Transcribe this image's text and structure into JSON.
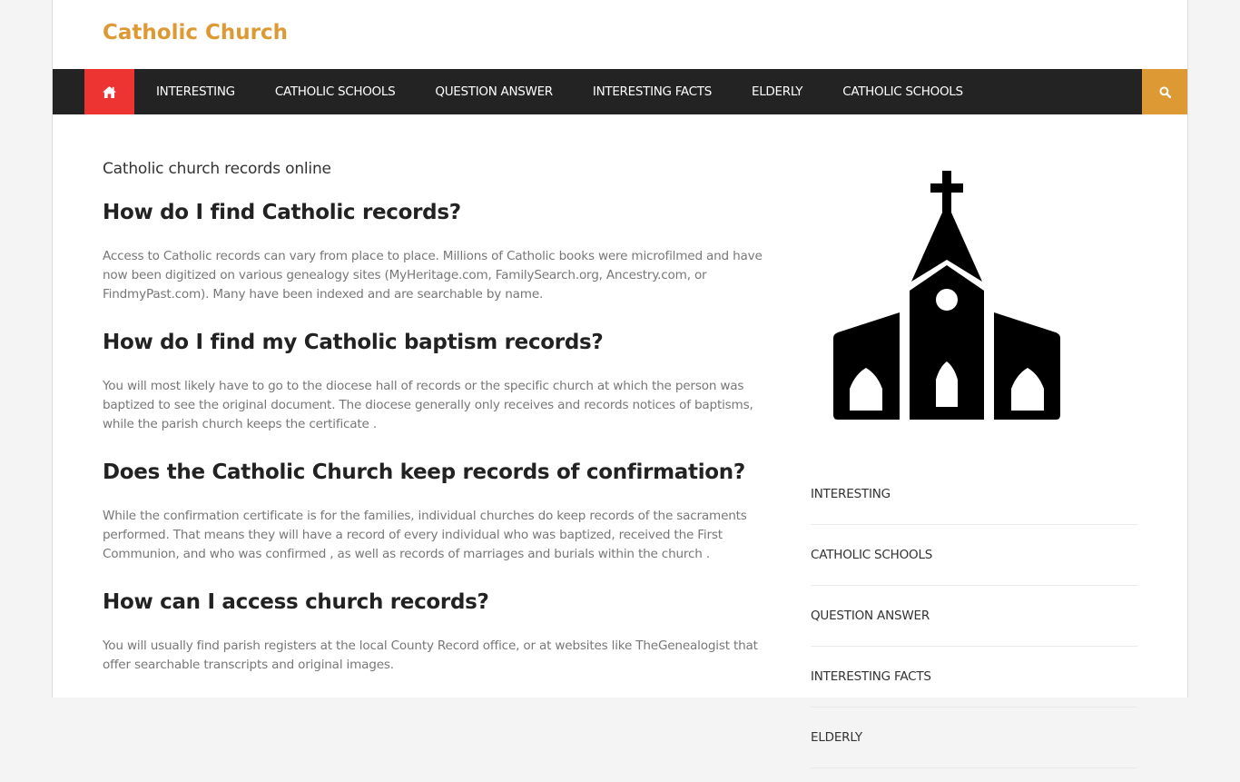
{
  "site": {
    "title": "Catholic Church",
    "accent_color": "#dd9933",
    "home_color": "#ee3333",
    "nav_bg": "#232323"
  },
  "nav": {
    "home_icon": "home-icon",
    "search_icon": "search-icon",
    "items": [
      {
        "label": "INTERESTING"
      },
      {
        "label": "CATHOLIC SCHOOLS"
      },
      {
        "label": "QUESTION ANSWER"
      },
      {
        "label": "INTERESTING FACTS"
      },
      {
        "label": "ELDERLY"
      },
      {
        "label": "CATHOLIC SCHOOLS"
      }
    ]
  },
  "main": {
    "subtitle": "Catholic church records online",
    "sections": [
      {
        "heading": "How do I find Catholic records?",
        "body": "Access to Catholic records can vary from place to place. Millions of Catholic books were microfilmed and have now been digitized on various genealogy sites (MyHeritage.com, FamilySearch.org, Ancestry.com, or FindmyPast.com). Many have been indexed and are searchable by name."
      },
      {
        "heading": "How do I find my Catholic baptism records?",
        "body": "You will most likely have to go to the diocese hall of records or the specific church at which the person was baptized to see the original document. The diocese generally only receives and records notices of baptisms, while the parish church keeps the certificate ."
      },
      {
        "heading": "Does the Catholic Church keep records of confirmation?",
        "body": "While the confirmation certificate is for the families, individual churches do keep records of the sacraments performed. That means they will have a record of every individual who was baptized, received the First Communion, and who was confirmed , as well as records of marriages and burials within the church ."
      },
      {
        "heading": "How can I access church records?",
        "body": "You will usually find parish registers at the local County Record office, or at websites like TheGenealogist that offer searchable transcripts and original images."
      }
    ]
  },
  "sidebar": {
    "image_icon": "church-icon",
    "categories": [
      {
        "label": "INTERESTING"
      },
      {
        "label": "CATHOLIC SCHOOLS"
      },
      {
        "label": "QUESTION ANSWER"
      },
      {
        "label": "INTERESTING FACTS"
      },
      {
        "label": "ELDERLY"
      }
    ]
  }
}
